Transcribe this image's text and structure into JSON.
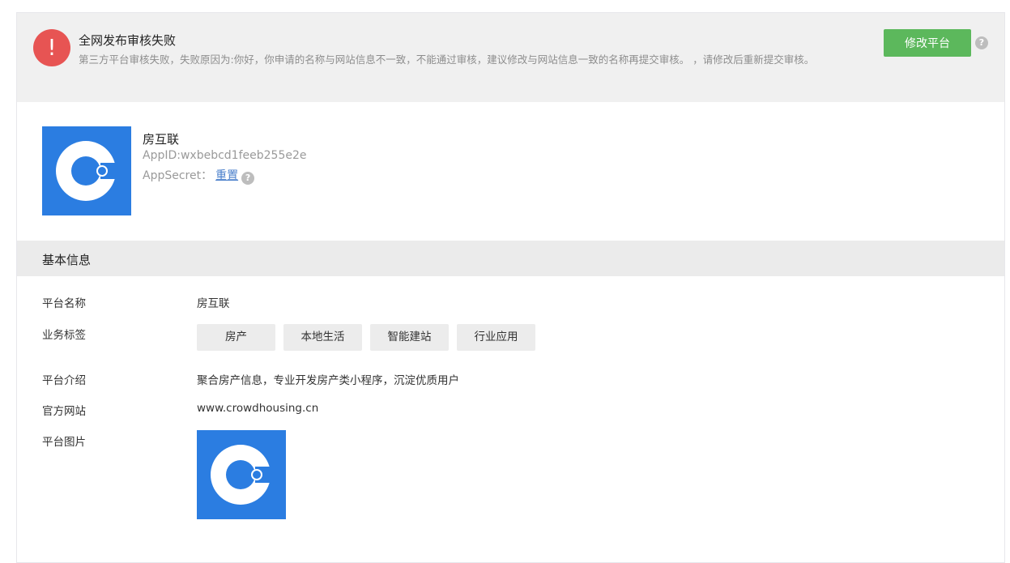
{
  "alert": {
    "title": "全网发布审核失败",
    "description": "第三方平台审核失败，失败原因为:你好，你申请的名称与网站信息不一致，不能通过审核，建议修改与网站信息一致的名称再提交审核。 ，请修改后重新提交审核。",
    "edit_button": "修改平台",
    "icon": "exclamation-icon",
    "colors": {
      "error": "#e75453",
      "accent": "#5cb85c"
    }
  },
  "app": {
    "name": "房互联",
    "app_id": "AppID:wxbebcd1feeb255e2e",
    "app_secret_label": "AppSecret：",
    "reset_label": "重置",
    "logo_color": "#2b7de1"
  },
  "basic_info": {
    "title": "基本信息",
    "platform_name_label": "平台名称",
    "platform_name": "房互联",
    "business_tags_label": "业务标签",
    "tags": [
      "房产",
      "本地生活",
      "智能建站",
      "行业应用"
    ],
    "intro_label": "平台介绍",
    "intro": "聚合房产信息，专业开发房产类小程序，沉淀优质用户",
    "website_label": "官方网站",
    "website": "www.crowdhousing.cn",
    "image_label": "平台图片"
  }
}
